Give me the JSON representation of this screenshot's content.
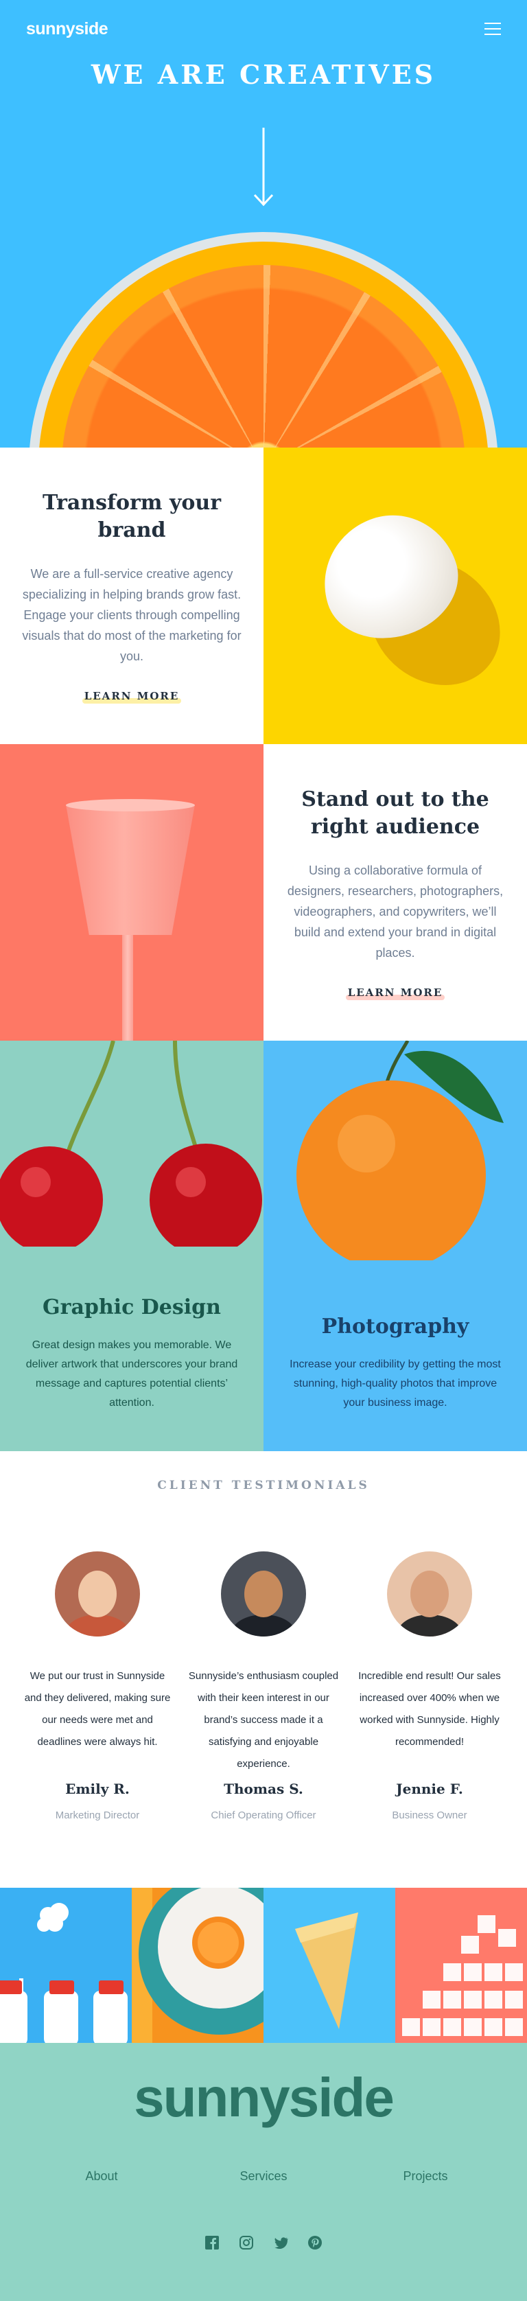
{
  "header": {
    "logo": "sunnyside",
    "menu_icon": "hamburger-menu-icon",
    "hero_title": "WE ARE CREATIVES",
    "arrow_icon": "arrow-down-icon"
  },
  "features": [
    {
      "title": "Transform your brand",
      "description": "We are a full-service creative agency specializing in helping brands grow fast. Engage your clients through compelling visuals that do most of the marketing for you.",
      "link": "LEARN MORE"
    },
    {
      "title": "Stand out to the right audience",
      "description": "Using a collaborative formula of designers, researchers, photographers, videographers, and copywriters, we’ll build and extend your brand in digital places.",
      "link": "LEARN MORE"
    }
  ],
  "services": [
    {
      "title": "Graphic Design",
      "description": "Great design makes you memorable. We deliver artwork that underscores your brand message and captures potential clients’ attention."
    },
    {
      "title": "Photography",
      "description": "Increase your credibility by getting the most stunning, high-quality photos that improve your business image."
    }
  ],
  "testimonials": {
    "heading": "CLIENT TESTIMONIALS",
    "items": [
      {
        "quote": "We put our trust in Sunnyside and they delivered, making sure our needs were met and deadlines were always hit.",
        "name": "Emily R.",
        "role": "Marketing Director"
      },
      {
        "quote": "Sunnyside’s enthusiasm coupled with their keen interest in our brand’s success made it a satisfying and enjoyable experience.",
        "name": "Thomas S.",
        "role": "Chief Operating Officer"
      },
      {
        "quote": "Incredible end result! Our sales increased over 400% when we worked with Sunnyside. Highly recommended!",
        "name": "Jennie F.",
        "role": "Business Owner"
      }
    ]
  },
  "footer": {
    "logo": "sunnyside",
    "nav": [
      "About",
      "Services",
      "Projects"
    ],
    "socials": [
      "facebook-icon",
      "instagram-icon",
      "twitter-icon",
      "pinterest-icon"
    ]
  },
  "colors": {
    "hero_blue": "#3ebfff",
    "yellow": "#fdd500",
    "coral": "#fe7865",
    "teal": "#8ed1c3",
    "sky": "#55bef9",
    "footer_teal": "#90d4c5",
    "dark_text": "#23303e"
  }
}
